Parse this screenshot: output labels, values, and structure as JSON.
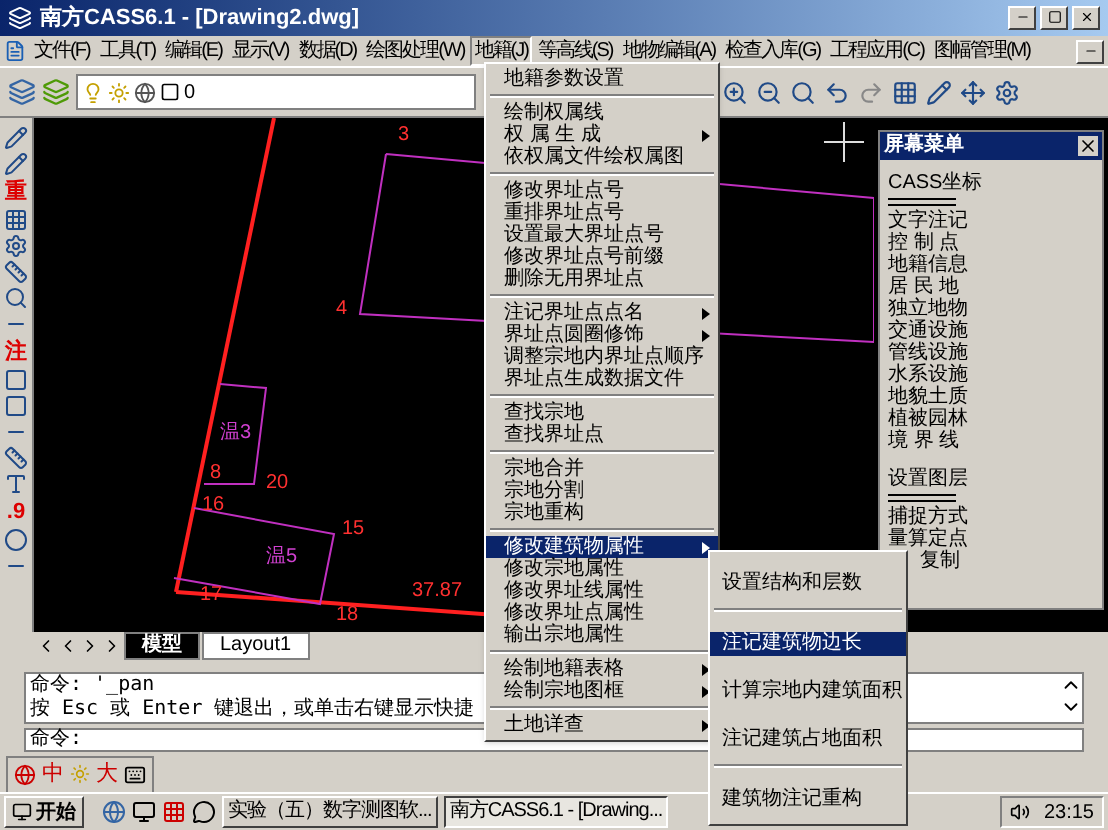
{
  "window": {
    "title": "南方CASS6.1 - [Drawing2.dwg]"
  },
  "menu_bar": [
    {
      "label": "文件(F)",
      "selected": false
    },
    {
      "label": "工具(T)",
      "selected": false
    },
    {
      "label": "编辑(E)",
      "selected": false
    },
    {
      "label": "显示(V)",
      "selected": false
    },
    {
      "label": "数据(D)",
      "selected": false
    },
    {
      "label": "绘图处理(W)",
      "selected": false
    },
    {
      "label": "地籍(J)",
      "selected": true
    },
    {
      "label": "等高线(S)",
      "selected": false
    },
    {
      "label": "地物编辑(A)",
      "selected": false
    },
    {
      "label": "检查入库(G)",
      "selected": false
    },
    {
      "label": "工程应用(C)",
      "selected": false
    },
    {
      "label": "图幅管理(M)",
      "selected": false
    }
  ],
  "layer_field": {
    "value": "0"
  },
  "left_toolbar_glyphs": [
    "重",
    "注",
    ".9"
  ],
  "canvas_labels": [
    {
      "text": "3",
      "color": "#ff3030"
    },
    {
      "text": "4",
      "color": "#ff3030"
    },
    {
      "text": "温3",
      "color": "#d040d0"
    },
    {
      "text": "8",
      "color": "#ff3030"
    },
    {
      "text": "20",
      "color": "#ff3030"
    },
    {
      "text": "16",
      "color": "#ff3030"
    },
    {
      "text": "15",
      "color": "#ff3030"
    },
    {
      "text": "温5",
      "color": "#d040d0"
    },
    {
      "text": "17",
      "color": "#ff3030"
    },
    {
      "text": "18",
      "color": "#ff3030"
    },
    {
      "text": "37.87",
      "color": "#ff3030"
    }
  ],
  "screen_menu": {
    "title": "屏幕菜单",
    "groups": [
      [
        "CASS坐标"
      ],
      [
        "文字注记",
        "控 制 点",
        "地籍信息",
        "居 民 地",
        "独立地物",
        "交通设施",
        "管线设施",
        "水系设施",
        "地貌土质",
        "植被园林",
        "境 界 线"
      ],
      [
        "设置图层"
      ],
      [
        "捕捉方式",
        "量算定点",
        "复制"
      ]
    ]
  },
  "dropdown": {
    "groups": [
      [
        {
          "label": "地籍参数设置",
          "submenu": false,
          "selected": false
        }
      ],
      [
        {
          "label": "绘制权属线",
          "submenu": false,
          "selected": false
        },
        {
          "label": "权 属 生 成",
          "submenu": true,
          "selected": false
        },
        {
          "label": "依权属文件绘权属图",
          "submenu": false,
          "selected": false
        }
      ],
      [
        {
          "label": "修改界址点号",
          "submenu": false,
          "selected": false
        },
        {
          "label": "重排界址点号",
          "submenu": false,
          "selected": false
        },
        {
          "label": "设置最大界址点号",
          "submenu": false,
          "selected": false
        },
        {
          "label": "修改界址点号前缀",
          "submenu": false,
          "selected": false
        },
        {
          "label": "删除无用界址点",
          "submenu": false,
          "selected": false
        }
      ],
      [
        {
          "label": "注记界址点点名",
          "submenu": true,
          "selected": false
        },
        {
          "label": "界址点圆圈修饰",
          "submenu": true,
          "selected": false
        },
        {
          "label": "调整宗地内界址点顺序",
          "submenu": false,
          "selected": false
        },
        {
          "label": "界址点生成数据文件",
          "submenu": false,
          "selected": false
        }
      ],
      [
        {
          "label": "查找宗地",
          "submenu": false,
          "selected": false
        },
        {
          "label": "查找界址点",
          "submenu": false,
          "selected": false
        }
      ],
      [
        {
          "label": "宗地合并",
          "submenu": false,
          "selected": false
        },
        {
          "label": "宗地分割",
          "submenu": false,
          "selected": false
        },
        {
          "label": "宗地重构",
          "submenu": false,
          "selected": false
        }
      ],
      [
        {
          "label": "修改建筑物属性",
          "submenu": true,
          "selected": true
        },
        {
          "label": "修改宗地属性",
          "submenu": false,
          "selected": false
        },
        {
          "label": "修改界址线属性",
          "submenu": false,
          "selected": false
        },
        {
          "label": "修改界址点属性",
          "submenu": false,
          "selected": false
        },
        {
          "label": "输出宗地属性",
          "submenu": false,
          "selected": false
        }
      ],
      [
        {
          "label": "绘制地籍表格",
          "submenu": true,
          "selected": false
        },
        {
          "label": "绘制宗地图框",
          "submenu": true,
          "selected": false
        }
      ],
      [
        {
          "label": "土地详查",
          "submenu": true,
          "selected": false
        }
      ]
    ]
  },
  "submenu": {
    "groups": [
      [
        {
          "label": "设置结构和层数",
          "selected": false
        }
      ],
      [
        {
          "label": "注记建筑物边长",
          "selected": true
        },
        {
          "label": "计算宗地内建筑面积",
          "selected": false
        },
        {
          "label": "注记建筑占地面积",
          "selected": false
        }
      ],
      [
        {
          "label": "建筑物注记重构",
          "selected": false
        }
      ]
    ]
  },
  "layout_tabs": [
    {
      "label": "模型",
      "selected": true
    },
    {
      "label": "Layout1",
      "selected": false
    }
  ],
  "command_history": [
    "命令: '_pan",
    "按 Esc 或 Enter 键退出，或单击右键显示快捷"
  ],
  "command_prompt": "命令:",
  "ime_bar": [
    "中",
    "大"
  ],
  "taskbar": {
    "start": "开始",
    "tasks": [
      {
        "label": "实验（五）数字测图软...",
        "selected": false
      },
      {
        "label": "南方CASS6.1 - [Drawing...",
        "selected": true
      }
    ],
    "clock": "23:15"
  }
}
